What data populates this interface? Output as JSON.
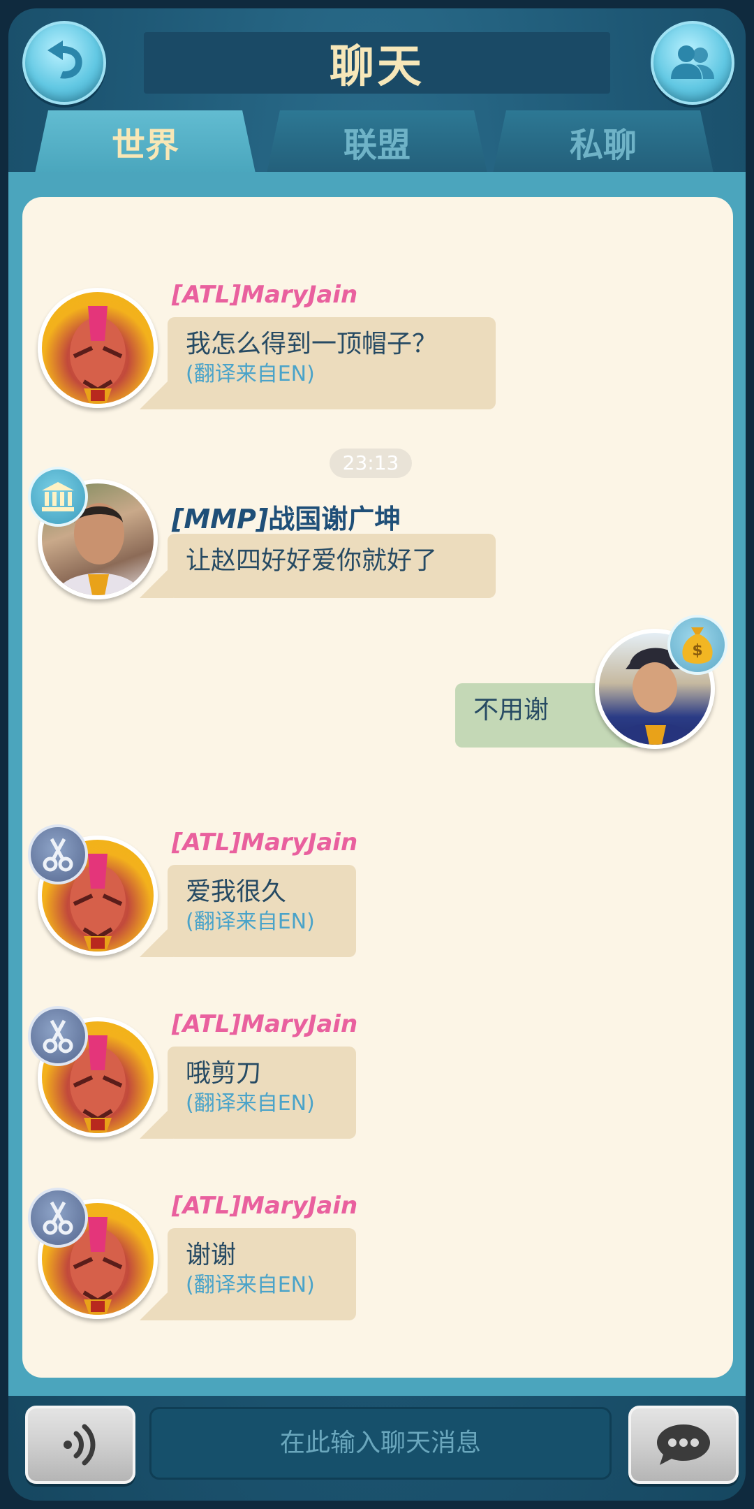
{
  "header": {
    "title": "聊天",
    "back_icon": "back-arrow-icon",
    "friends_icon": "friends-icon"
  },
  "tabs": [
    {
      "label": "世界",
      "active": true
    },
    {
      "label": "联盟",
      "active": false
    },
    {
      "label": "私聊",
      "active": false
    }
  ],
  "messages": [
    {
      "name": "[ATL]MaryJain",
      "text": "我怎么得到一顶帽子？",
      "translation": "(翻译来自EN)",
      "avatar": "hero-avatar",
      "badge": null
    },
    {
      "timestamp": "23:13"
    },
    {
      "name": "[MMP]战国谢广坤",
      "name_tag": "[MMP]",
      "name_rest": "战国谢广坤",
      "text": "让赵四好好爱你就好了",
      "avatar": "photo-avatar",
      "badge": "bank-icon"
    },
    {
      "self": true,
      "text": "不用谢",
      "avatar": "photo-avatar",
      "badge": "money-bag-icon"
    },
    {
      "name": "[ATL]MaryJain",
      "text": "爱我很久",
      "translation": "(翻译来自EN)",
      "avatar": "hero-avatar",
      "badge": "scissors-icon"
    },
    {
      "name": "[ATL]MaryJain",
      "text": "哦剪刀",
      "translation": "(翻译来自EN)",
      "avatar": "hero-avatar",
      "badge": "scissors-icon"
    },
    {
      "name": "[ATL]MaryJain",
      "text": "谢谢",
      "translation": "(翻译来自EN)",
      "avatar": "hero-avatar",
      "badge": "scissors-icon"
    }
  ],
  "input": {
    "placeholder": "在此输入聊天消息",
    "voice_icon": "voice-icon",
    "send_icon": "chat-bubble-icon"
  },
  "colors": {
    "name_pink": "#e9609e",
    "name_blue": "#1f4f78",
    "tab_active_text": "#f8e7b6",
    "chat_background": "#fcf5e6",
    "bubble": "#ecdcbd",
    "bubble_self": "#c4d8b6"
  }
}
